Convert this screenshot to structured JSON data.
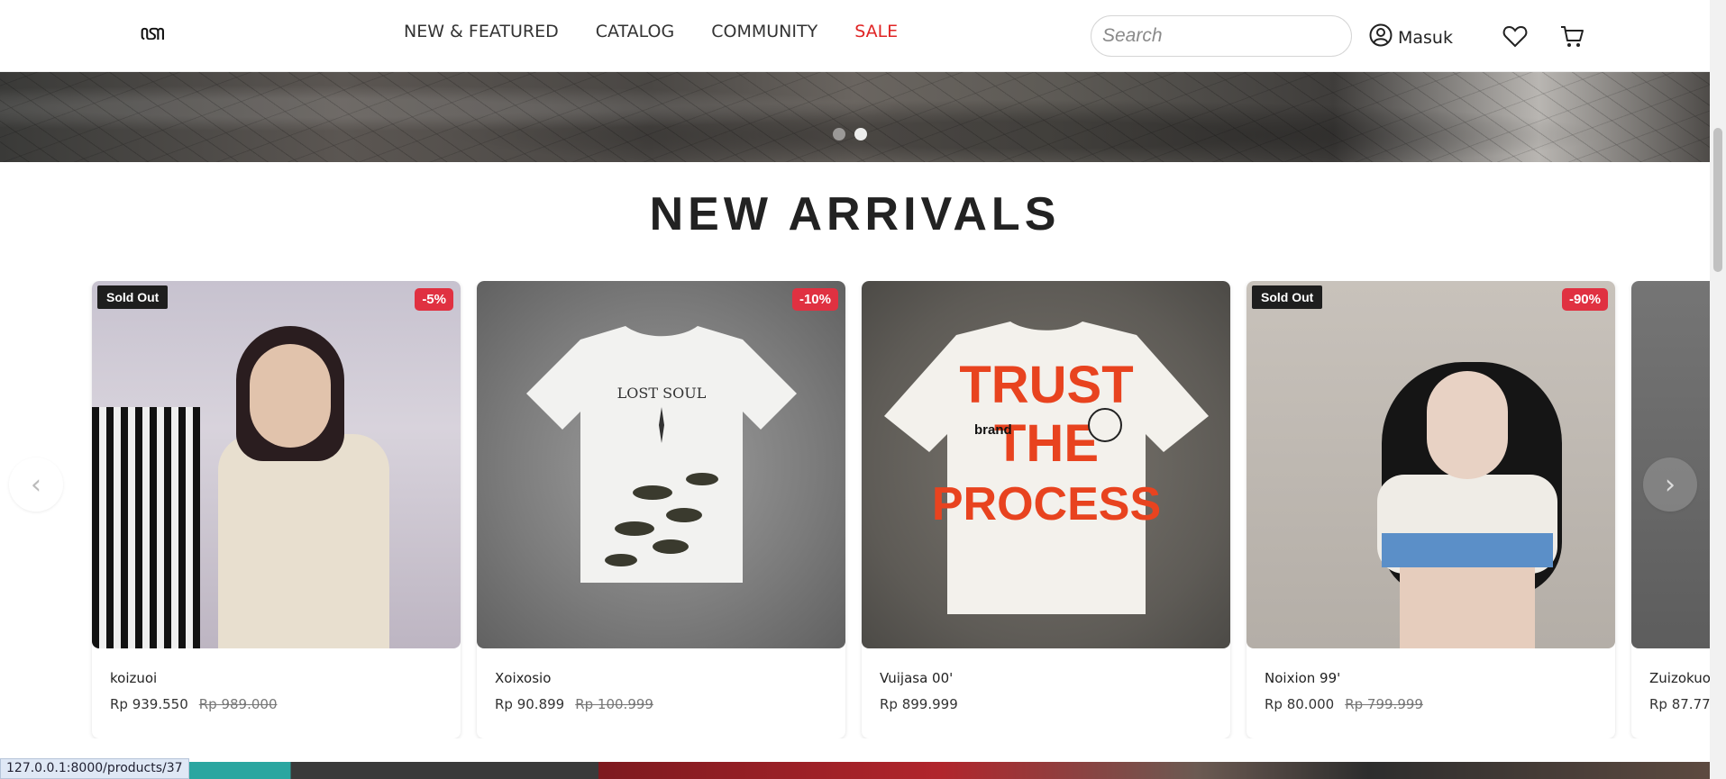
{
  "header": {
    "logo_text": "ꦠ",
    "nav": [
      "NEW & FEATURED",
      "CATALOG",
      "COMMUNITY",
      "SALE"
    ],
    "search_placeholder": "Search",
    "account_label": "Masuk"
  },
  "hero": {
    "slides": 2,
    "active_slide": 2
  },
  "section": {
    "title": "NEW ARRIVALS"
  },
  "products": [
    {
      "name": "koizuoi",
      "price": "Rp 939.550",
      "old_price": "Rp 989.000",
      "badge_left": "Sold Out",
      "badge_right": "-5%"
    },
    {
      "name": "Xoixosio",
      "price": "Rp 90.899",
      "old_price": "Rp 100.999",
      "badge_left": "",
      "badge_right": "-10%"
    },
    {
      "name": "Vuijasa 00'",
      "price": "Rp 899.999",
      "old_price": "",
      "badge_left": "",
      "badge_right": ""
    },
    {
      "name": "Noixion 99'",
      "price": "Rp 80.000",
      "old_price": "Rp 799.999",
      "badge_left": "Sold Out",
      "badge_right": "-90%"
    },
    {
      "name": "Zuizokuo",
      "price": "Rp 87.77",
      "old_price": "",
      "badge_left": "",
      "badge_right": ""
    }
  ],
  "carousel": {
    "prev": "‹",
    "next": "›"
  },
  "status_url": "127.0.0.1:8000/products/37",
  "colors": {
    "sale": "#e02424",
    "discount_badge": "#e03141",
    "soldout_badge": "#1e1e1e"
  }
}
